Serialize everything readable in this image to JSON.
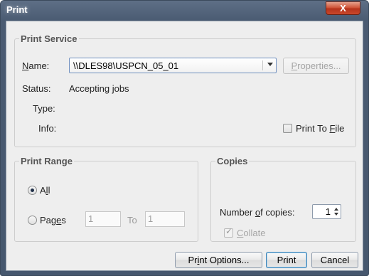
{
  "window": {
    "title": "Print",
    "close_label": "X"
  },
  "print_service": {
    "legend": "Print Service",
    "name_label": "Name:",
    "printer_value": "\\\\DLES98\\USPCN_05_01",
    "properties_label": "Properties...",
    "status_label": "Status:",
    "status_value": "Accepting jobs",
    "type_label": "Type:",
    "info_label": "Info:",
    "print_to_file_label": "Print To File",
    "print_to_file_checked": false
  },
  "print_range": {
    "legend": "Print Range",
    "all_label": "All",
    "all_selected": true,
    "pages_label": "Pages",
    "from_value": "1",
    "to_label": "To",
    "to_value": "1"
  },
  "copies": {
    "legend": "Copies",
    "number_label": "Number of copies:",
    "number_value": "1",
    "collate_label": "Collate",
    "collate_checked": true
  },
  "buttons": {
    "print_options": "Print Options...",
    "print": "Print",
    "cancel": "Cancel"
  }
}
